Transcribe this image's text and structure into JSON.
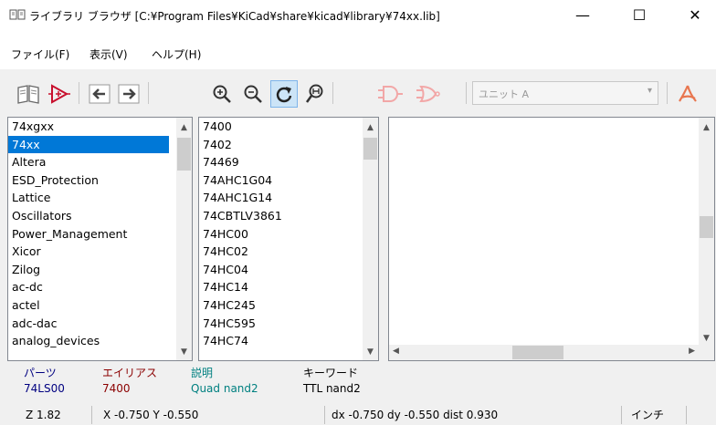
{
  "window": {
    "title": "ライブラリ ブラウザ [C:¥Program Files¥KiCad¥share¥kicad¥library¥74xx.lib]",
    "minimize_glyph": "—",
    "maximize_glyph": "☐",
    "close_glyph": "✕"
  },
  "menu": {
    "file": "ファイル(F)",
    "view": "表示(V)",
    "help": "ヘルプ(H)"
  },
  "toolbar": {
    "unit_select_value": "ユニット A",
    "active_tool": "redraw"
  },
  "libraries": {
    "items": [
      "74xgxx",
      "74xx",
      "Altera",
      "ESD_Protection",
      "Lattice",
      "Oscillators",
      "Power_Management",
      "Xicor",
      "Zilog",
      "ac-dc",
      "actel",
      "adc-dac",
      "analog_devices"
    ],
    "selected_index": 1
  },
  "components": {
    "items": [
      "7400",
      "7402",
      "74469",
      "74AHC1G04",
      "74AHC1G14",
      "74CBTLV3861",
      "74HC00",
      "74HC02",
      "74HC04",
      "74HC14",
      "74HC245",
      "74HC595",
      "74HC74"
    ]
  },
  "message_panel": {
    "part_header": "パーツ",
    "part_value": "74LS00",
    "alias_header": "エイリアス",
    "alias_value": "7400",
    "desc_header": "説明",
    "desc_value": "Quad nand2",
    "keyword_header": "キーワード",
    "keyword_value": "TTL nand2"
  },
  "status": {
    "zoom": "Z 1.82",
    "coords": "X -0.750  Y -0.550",
    "delta": "dx -0.750  dy -0.550  dist 0.930",
    "units": "インチ"
  },
  "colors": {
    "part": "#000080",
    "alias": "#8b0000",
    "description": "#008080",
    "keyword": "#000000",
    "selection": "#0078d7",
    "pdf_icon": "#e8764f"
  }
}
